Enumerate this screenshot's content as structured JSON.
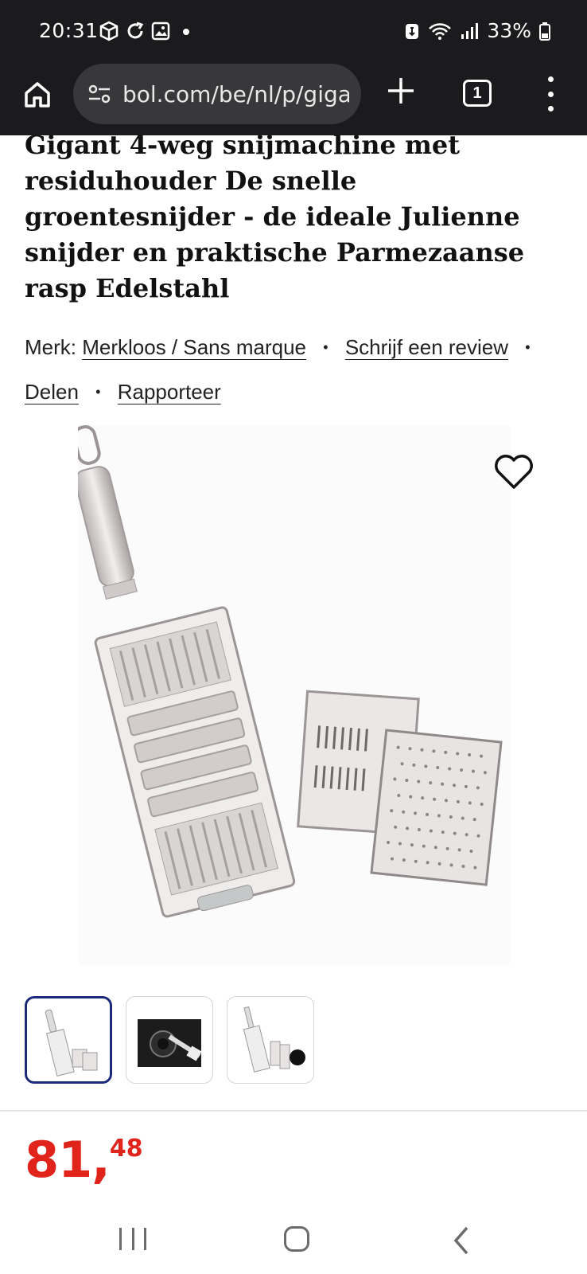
{
  "status_bar": {
    "time": "20:31",
    "battery": "33%"
  },
  "browser": {
    "url": "bol.com/be/nl/p/giga",
    "tab_count": "1",
    "icons": [
      "home-icon",
      "site-settings-icon",
      "plus-icon",
      "tab-switcher-icon",
      "more-vert-icon"
    ]
  },
  "product": {
    "title": "Gigant 4-weg snijmachine met residuhouder De snelle groentesnijder - de ideale Julienne snijder en praktische Parmezaanse rasp Edelstahl",
    "brand_label": "Merk:",
    "brand_name": "Merkloos / Sans marque",
    "review_link": "Schrijf een review",
    "share_link": "Delen",
    "report_link": "Rapporteer",
    "separator": "•",
    "price_main": "81,",
    "price_cents": "48",
    "thumbnail_count": 3,
    "active_thumbnail": 1
  },
  "colors": {
    "price": "#e1241b",
    "active_thumb_border": "#1c2a7a",
    "chrome_bg": "#1b1b1d",
    "urlbar_bg": "#38383b"
  }
}
